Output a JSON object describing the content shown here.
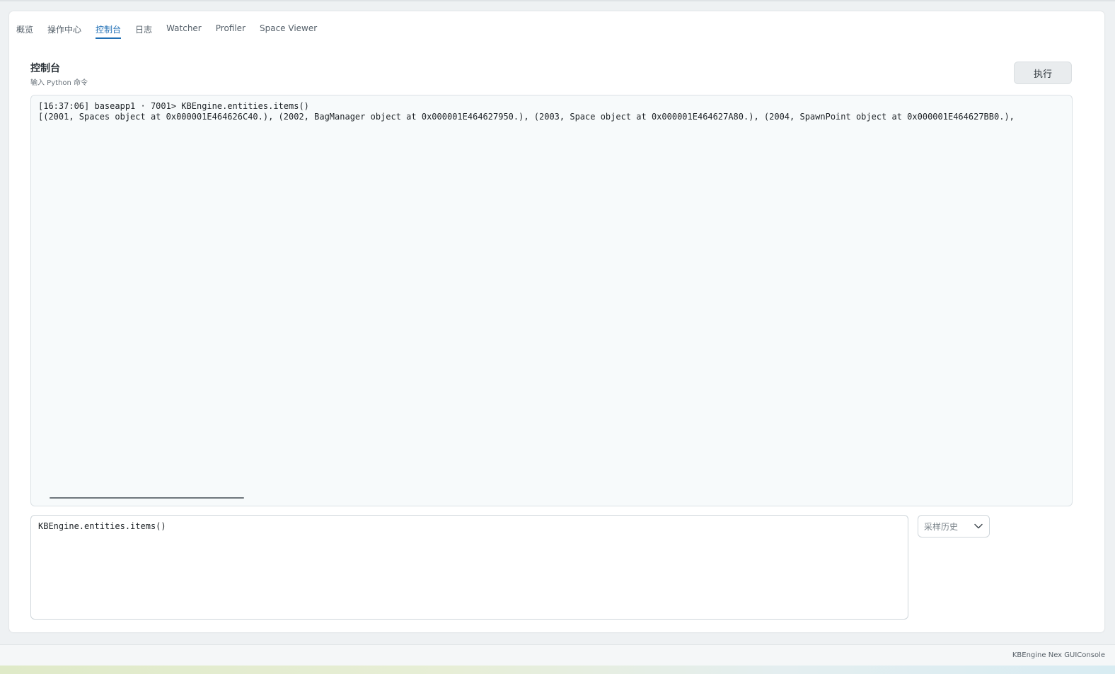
{
  "tabs": [
    {
      "label": "概览",
      "active": false
    },
    {
      "label": "操作中心",
      "active": false
    },
    {
      "label": "控制台",
      "active": true
    },
    {
      "label": "日志",
      "active": false
    },
    {
      "label": "Watcher",
      "active": false
    },
    {
      "label": "Profiler",
      "active": false
    },
    {
      "label": "Space Viewer",
      "active": false
    }
  ],
  "section": {
    "title": "控制台",
    "subtitle": "输入 Python 命令"
  },
  "toolbar": {
    "execute_label": "执行"
  },
  "output": {
    "lines": [
      "[16:37:06] baseapp1 · 7001> KBEngine.entities.items()",
      "[(2001, Spaces object at 0x000001E464626C40.), (2002, BagManager object at 0x000001E464627950.), (2003, Space object at 0x000001E464627A80.), (2004, SpawnPoint object at 0x000001E464627BB0.),"
    ]
  },
  "input": {
    "value": "KBEngine.entities.items()"
  },
  "history": {
    "label": "采样历史",
    "icon": "chevron-down-icon"
  },
  "footer": {
    "text": "KBEngine Nex GUIConsole"
  },
  "colors": {
    "accent": "#1f6fb5",
    "panel_bg": "#f7fafb"
  }
}
